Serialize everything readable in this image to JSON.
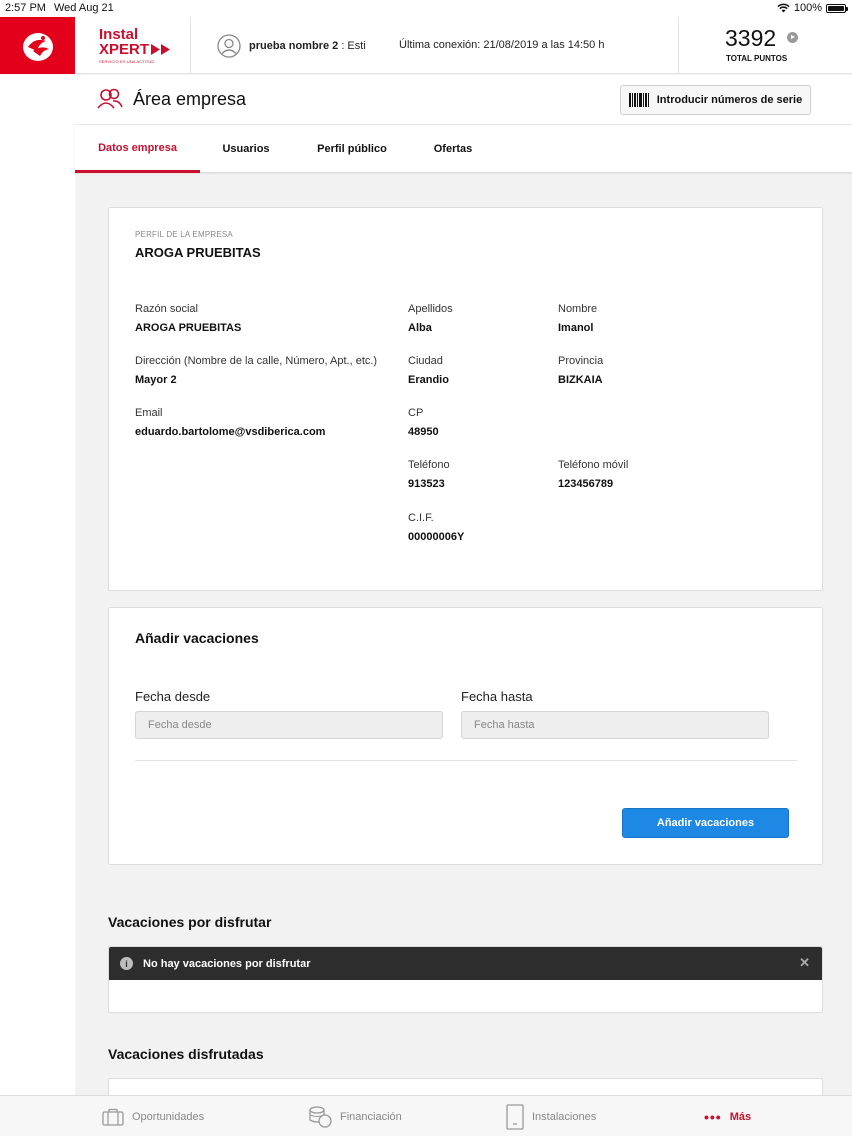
{
  "status_bar": {
    "time": "2:57 PM",
    "date": "Wed Aug 21",
    "battery": "100%"
  },
  "header": {
    "logo_line1": "Instal",
    "logo_line2": "XPERT",
    "logo_tagline": "SERVICIO ES UNA ACTITUD",
    "user_name": "prueba nombre 2",
    "user_suffix": ": Esti",
    "last_connection": "Última conexión: 21/08/2019 a las 14:50 h",
    "points": "3392",
    "points_label": "TOTAL PUNTOS"
  },
  "page": {
    "title": "Área empresa",
    "serial_button": "Introducir números de serie"
  },
  "tabs": [
    {
      "label": "Datos empresa",
      "active": true
    },
    {
      "label": "Usuarios",
      "active": false
    },
    {
      "label": "Perfil público",
      "active": false
    },
    {
      "label": "Ofertas",
      "active": false
    }
  ],
  "profile": {
    "section_label": "PERFIL DE LA EMPRESA",
    "company_name": "AROGA PRUEBITAS",
    "fields": {
      "razon_social": {
        "label": "Razón social",
        "value": "AROGA PRUEBITAS"
      },
      "apellidos": {
        "label": "Apellidos",
        "value": "Alba"
      },
      "nombre": {
        "label": "Nombre",
        "value": "Imanol"
      },
      "direccion": {
        "label": "Dirección (Nombre de la calle, Número, Apt., etc.)",
        "value": "Mayor 2"
      },
      "ciudad": {
        "label": "Ciudad",
        "value": "Erandio"
      },
      "provincia": {
        "label": "Provincia",
        "value": "BIZKAIA"
      },
      "email": {
        "label": "Email",
        "value": "eduardo.bartolome@vsdiberica.com"
      },
      "cp": {
        "label": "CP",
        "value": "48950"
      },
      "telefono": {
        "label": "Teléfono",
        "value": "913523"
      },
      "movil": {
        "label": "Teléfono móvil",
        "value": "123456789"
      },
      "cif": {
        "label": "C.I.F.",
        "value": "00000006Y"
      }
    }
  },
  "vacations": {
    "title": "Añadir vacaciones",
    "from_label": "Fecha desde",
    "from_placeholder": "Fecha desde",
    "to_label": "Fecha hasta",
    "to_placeholder": "Fecha hasta",
    "add_button": "Añadir vacaciones",
    "pending_title": "Vacaciones por disfrutar",
    "pending_empty": "No hay vacaciones por disfrutar",
    "enjoyed_title": "Vacaciones disfrutadas"
  },
  "bottom_nav": [
    {
      "label": "Oportunidades",
      "icon": "briefcase-icon"
    },
    {
      "label": "Financiación",
      "icon": "coins-icon"
    },
    {
      "label": "Instalaciones",
      "icon": "device-icon"
    },
    {
      "label": "Más",
      "icon": "more-dots-icon",
      "active": true
    }
  ],
  "colors": {
    "brand_red": "#e2001a",
    "accent_red": "#c8102e",
    "button_blue": "#1e88e5",
    "alert_dark": "#2d2d2d"
  }
}
